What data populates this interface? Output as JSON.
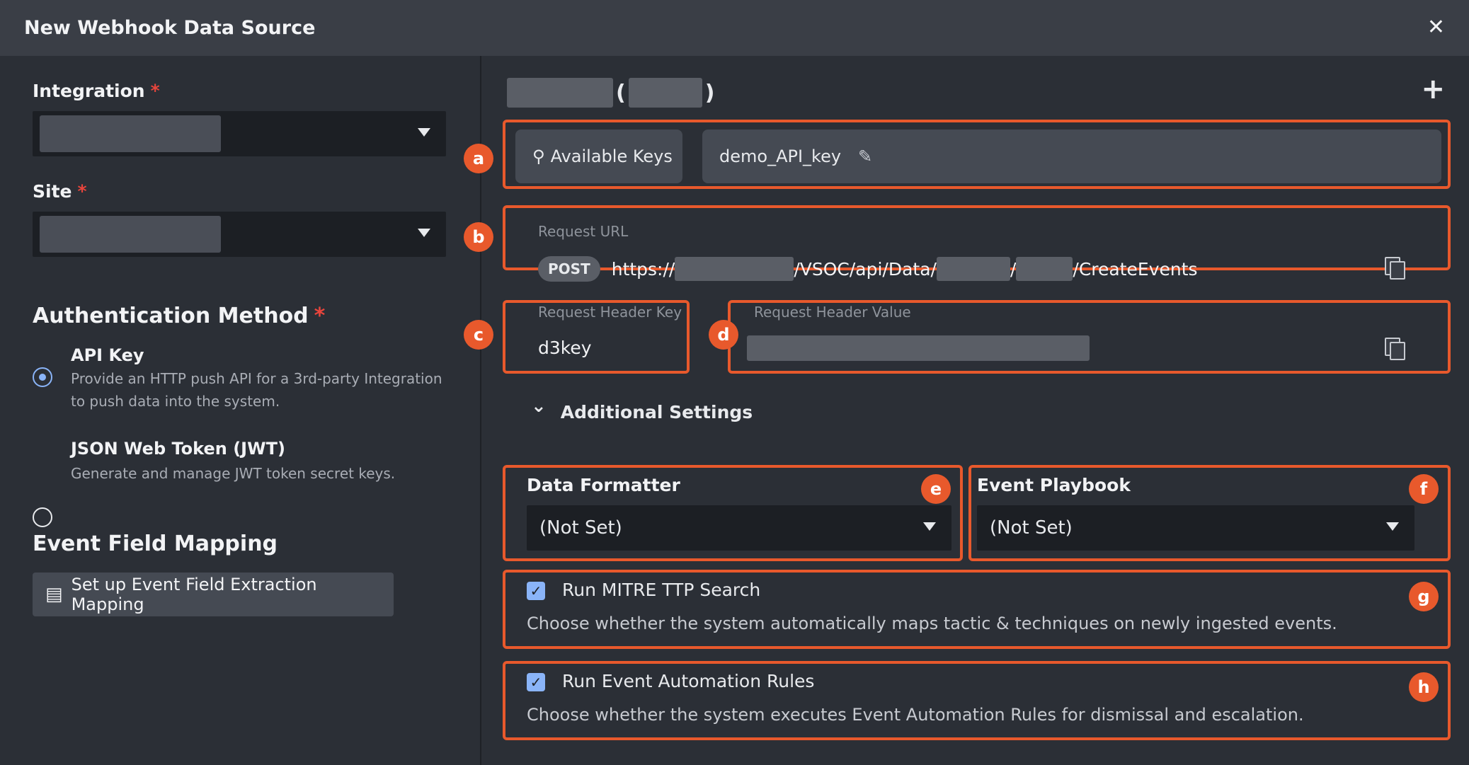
{
  "window": {
    "title": "New Webhook Data Source",
    "close_label": "✕"
  },
  "left": {
    "integration": {
      "label": "Integration",
      "required_mark": "*"
    },
    "site": {
      "label": "Site",
      "required_mark": "*"
    },
    "auth": {
      "title": "Authentication Method",
      "required_mark": "*",
      "options": [
        {
          "title": "API Key",
          "desc_line1": "Provide an HTTP push API for a 3rd-party Integration",
          "desc_line2": "to push data into the system.",
          "selected": true
        },
        {
          "title": "JSON Web Token (JWT)",
          "desc_line1": "Generate and manage JWT token secret keys.",
          "selected": false
        }
      ]
    },
    "mapping": {
      "title": "Event Field Mapping",
      "button_label": "Set up Event Field Extraction Mapping",
      "button_icon": "list-icon"
    }
  },
  "right": {
    "header": {
      "open_paren": "(",
      "close_paren": ")",
      "add_label": "+"
    },
    "keys": {
      "badge": "a",
      "available_label": "Available Keys",
      "key_icon": "key-icon",
      "key_name": "demo_API_key",
      "edit_icon": "pencil-icon"
    },
    "request_url": {
      "badge": "b",
      "label": "Request URL",
      "method": "POST",
      "prefix": "https://",
      "seg1": "/VSOC/api/Data/",
      "seg2": "/",
      "seg3": "/CreateEvents"
    },
    "header_key": {
      "badge": "c",
      "label": "Request Header Key",
      "value": "d3key"
    },
    "header_value": {
      "badge": "d",
      "label": "Request Header Value"
    },
    "additional": {
      "label": "Additional Settings",
      "chevron": "⌄"
    },
    "formatter": {
      "badge": "e",
      "label": "Data Formatter",
      "value": "(Not Set)"
    },
    "playbook": {
      "badge": "f",
      "label": "Event Playbook",
      "value": "(Not Set)"
    },
    "mitre": {
      "badge": "g",
      "label": "Run MITRE TTP Search",
      "desc": "Choose whether the system automatically maps tactic & techniques on newly ingested events.",
      "checked": true
    },
    "automation": {
      "badge": "h",
      "label": "Run Event Automation Rules",
      "desc": "Choose whether the system executes Event Automation Rules for dismissal and escalation.",
      "checked": true
    }
  },
  "colors": {
    "highlight": "#e8592c",
    "accent": "#8ab4f8",
    "required": "#e8453c"
  }
}
